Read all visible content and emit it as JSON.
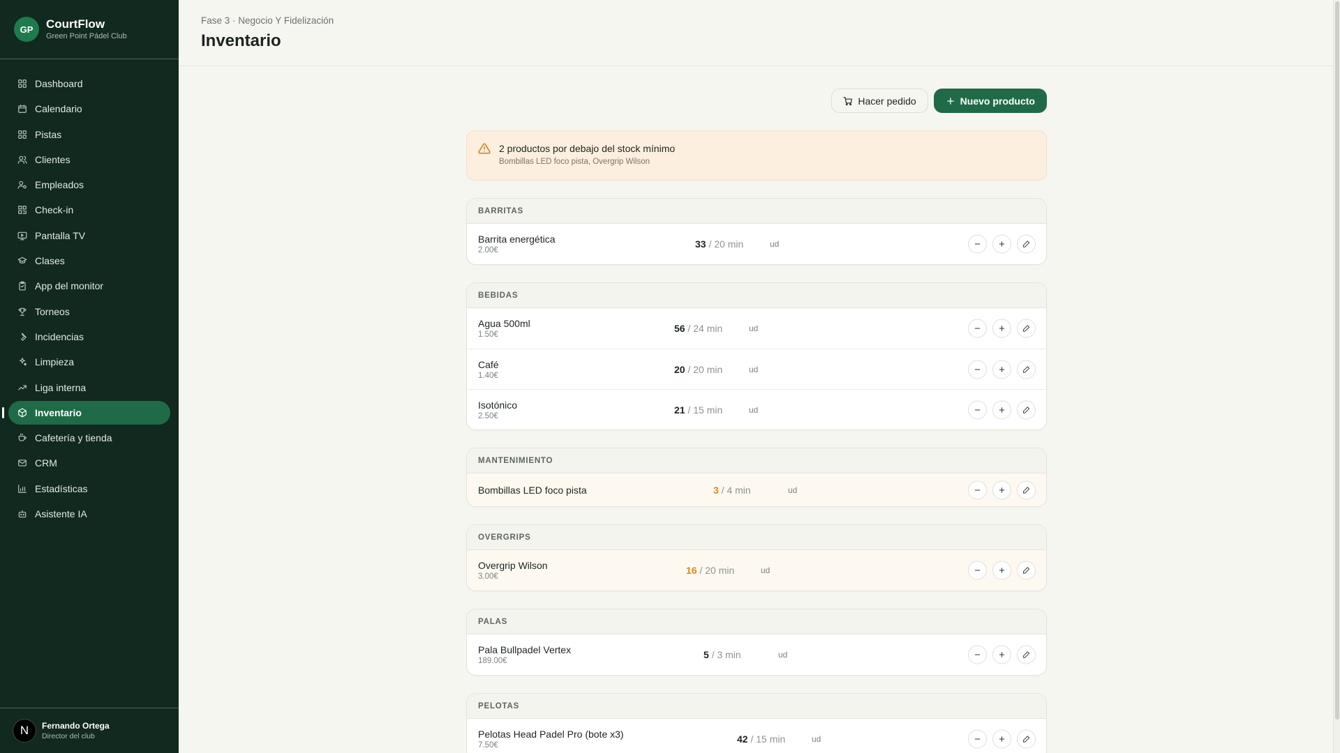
{
  "brand": {
    "initials": "GP",
    "name": "CourtFlow",
    "club": "Green Point Pádel Club"
  },
  "nav": [
    {
      "label": "Dashboard",
      "icon": "grid-icon"
    },
    {
      "label": "Calendario",
      "icon": "calendar-icon"
    },
    {
      "label": "Pistas",
      "icon": "grid-icon"
    },
    {
      "label": "Clientes",
      "icon": "users-icon"
    },
    {
      "label": "Empleados",
      "icon": "user-cog-icon"
    },
    {
      "label": "Check-in",
      "icon": "qr-icon"
    },
    {
      "label": "Pantalla TV",
      "icon": "tv-icon"
    },
    {
      "label": "Clases",
      "icon": "graduation-icon"
    },
    {
      "label": "App del monitor",
      "icon": "clipboard-icon"
    },
    {
      "label": "Torneos",
      "icon": "trophy-icon"
    },
    {
      "label": "Incidencias",
      "icon": "wrench-icon"
    },
    {
      "label": "Limpieza",
      "icon": "sparkles-icon"
    },
    {
      "label": "Liga interna",
      "icon": "trend-icon"
    },
    {
      "label": "Inventario",
      "icon": "box-icon",
      "active": true
    },
    {
      "label": "Cafetería y tienda",
      "icon": "coffee-icon"
    },
    {
      "label": "CRM",
      "icon": "mail-icon"
    },
    {
      "label": "Estadísticas",
      "icon": "chart-icon"
    },
    {
      "label": "Asistente IA",
      "icon": "bot-icon"
    }
  ],
  "user": {
    "initial": "N",
    "name": "Fernando Ortega",
    "role": "Director del club"
  },
  "header": {
    "breadcrumb": "Fase 3 · Negocio Y Fidelización",
    "title": "Inventario"
  },
  "actions": {
    "order_label": "Hacer pedido",
    "new_label": "Nuevo producto"
  },
  "alert": {
    "title": "2 productos por debajo del stock mínimo",
    "detail": "Bombillas LED foco pista, Overgrip Wilson",
    "color": "#d27a16"
  },
  "categories": [
    {
      "name": "BARRITAS",
      "products": [
        {
          "name": "Barrita energética",
          "price": "2.00€",
          "stock": "33",
          "min": "/ 20 min",
          "unit": "ud",
          "low": false
        }
      ]
    },
    {
      "name": "BEBIDAS",
      "products": [
        {
          "name": "Agua 500ml",
          "price": "1.50€",
          "stock": "56",
          "min": "/ 24 min",
          "unit": "ud",
          "low": false
        },
        {
          "name": "Café",
          "price": "1.40€",
          "stock": "20",
          "min": "/ 20 min",
          "unit": "ud",
          "low": false
        },
        {
          "name": "Isotónico",
          "price": "2.50€",
          "stock": "21",
          "min": "/ 15 min",
          "unit": "ud",
          "low": false
        }
      ]
    },
    {
      "name": "MANTENIMIENTO",
      "products": [
        {
          "name": "Bombillas LED foco pista",
          "price": "",
          "stock": "3",
          "min": "/ 4 min",
          "unit": "ud",
          "low": true
        }
      ]
    },
    {
      "name": "OVERGRIPS",
      "products": [
        {
          "name": "Overgrip Wilson",
          "price": "3.00€",
          "stock": "16",
          "min": "/ 20 min",
          "unit": "ud",
          "low": true
        }
      ]
    },
    {
      "name": "PALAS",
      "products": [
        {
          "name": "Pala Bullpadel Vertex",
          "price": "189.00€",
          "stock": "5",
          "min": "/ 3 min",
          "unit": "ud",
          "low": false
        }
      ]
    },
    {
      "name": "PELOTAS",
      "products": [
        {
          "name": "Pelotas Head Padel Pro (bote x3)",
          "price": "7.50€",
          "stock": "42",
          "min": "/ 15 min",
          "unit": "ud",
          "low": false
        }
      ]
    }
  ],
  "colors": {
    "sidebar": "#11291f",
    "primary": "#1f6b47",
    "warning": "#d88a18",
    "alert_bg": "#fcefdf"
  }
}
